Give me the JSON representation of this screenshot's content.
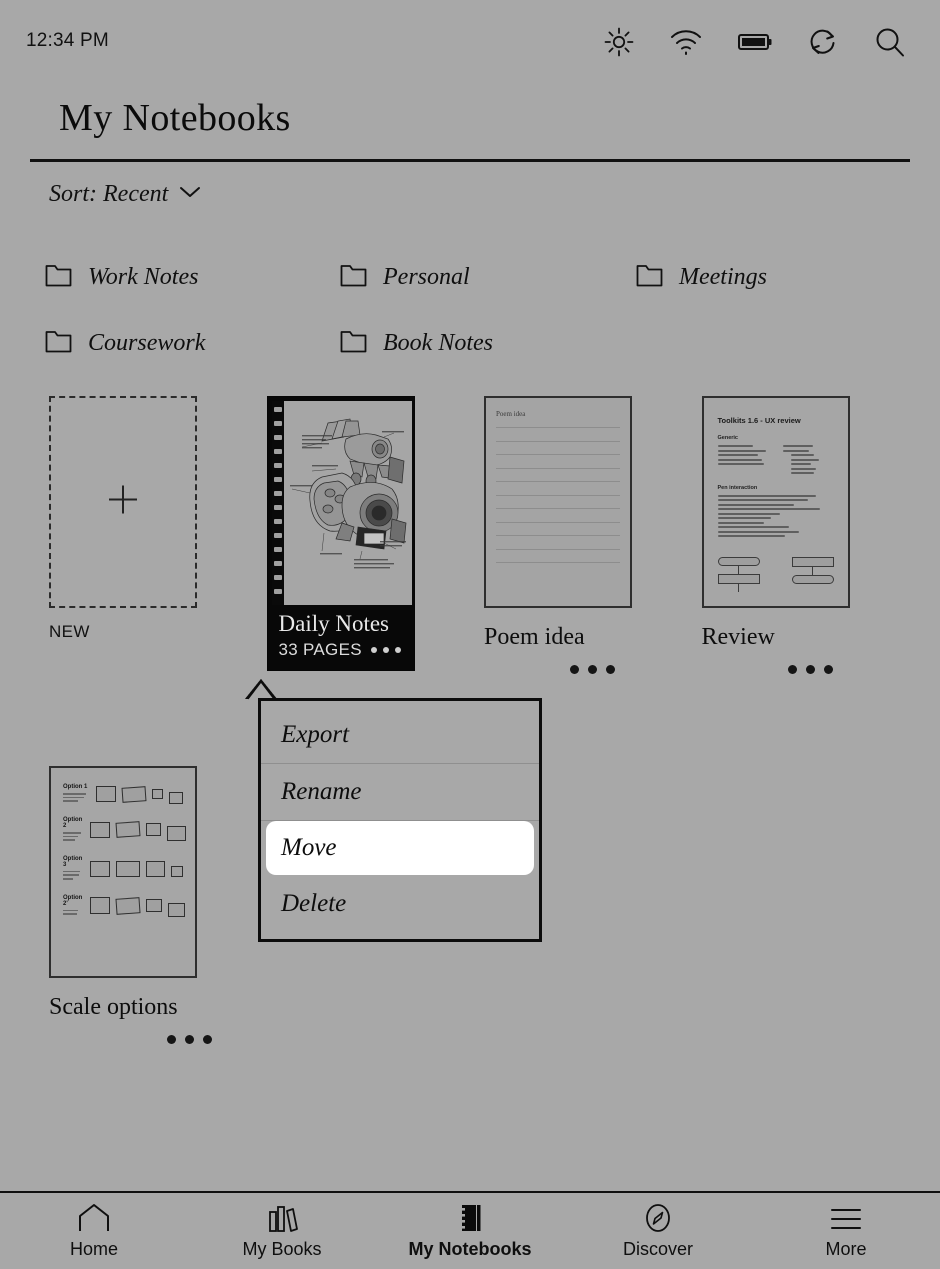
{
  "statusbar": {
    "time": "12:34 PM",
    "icons": [
      {
        "name": "brightness-icon",
        "label": "brightness"
      },
      {
        "name": "wifi-icon",
        "label": "wifi"
      },
      {
        "name": "battery-icon",
        "label": "battery"
      },
      {
        "name": "refresh-icon",
        "label": "refresh"
      },
      {
        "name": "search-icon",
        "label": "search"
      }
    ]
  },
  "header": {
    "title": "My Notebooks"
  },
  "sort": {
    "label": "Sort: Recent",
    "chevron": "chevron-down-icon"
  },
  "folders": [
    {
      "name": "Work Notes"
    },
    {
      "name": "Personal"
    },
    {
      "name": "Meetings"
    },
    {
      "name": "Coursework"
    },
    {
      "name": "Book Notes"
    }
  ],
  "new_card": {
    "label": "NEW",
    "icon": "plus-icon"
  },
  "notebooks": [
    {
      "title": "Daily Notes",
      "subtitle": "33 PAGES",
      "selected": true,
      "thumbnail": "mechanical-sketch-spiral-notebook"
    },
    {
      "title": "Poem idea",
      "subtitle": "",
      "selected": false,
      "thumbnail": "ruled-page",
      "thumb_header": "Poem idea"
    },
    {
      "title": "Review",
      "subtitle": "",
      "selected": false,
      "thumbnail": "ux-review-document",
      "doc": {
        "title": "Toolkits 1.6 - UX review",
        "sections": [
          "Generic",
          "Pen interaction"
        ]
      }
    },
    {
      "title": "Scale options",
      "subtitle": "",
      "selected": false,
      "thumbnail": "scale-options-diagram",
      "doc": {
        "options": [
          "Option 1",
          "Option 2",
          "Option 3",
          "Option 2'"
        ]
      }
    }
  ],
  "context_menu": {
    "items": [
      {
        "label": "Export",
        "active": false
      },
      {
        "label": "Rename",
        "active": false
      },
      {
        "label": "Move",
        "active": true
      },
      {
        "label": "Delete",
        "active": false
      }
    ]
  },
  "nav": [
    {
      "label": "Home",
      "icon": "home-icon",
      "active": false
    },
    {
      "label": "My Books",
      "icon": "books-icon",
      "active": false
    },
    {
      "label": "My Notebooks",
      "icon": "notebook-icon",
      "active": true
    },
    {
      "label": "Discover",
      "icon": "compass-icon",
      "active": false
    },
    {
      "label": "More",
      "icon": "menu-icon",
      "active": false
    }
  ],
  "colors": {
    "background": "#a8a8a8",
    "ink": "#0d0d0d",
    "selected_card": "#080808",
    "highlight": "#ffffff"
  }
}
